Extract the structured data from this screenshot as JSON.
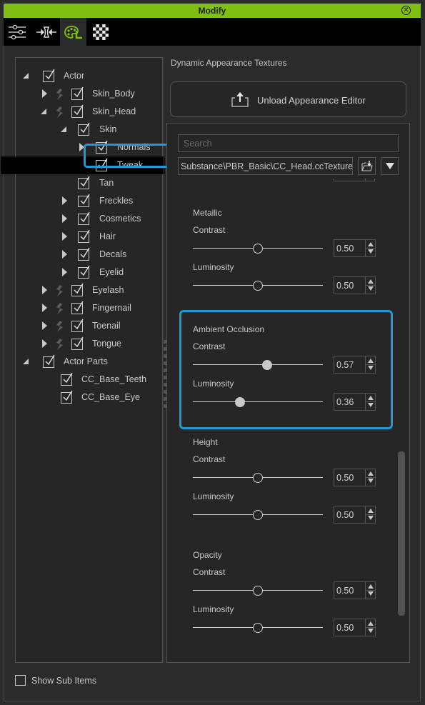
{
  "window": {
    "title": "Modify",
    "close_icon": "close-circle-icon"
  },
  "toolbar": {
    "tabs": [
      {
        "name": "sliders",
        "icon": "sliders-icon",
        "active": false
      },
      {
        "name": "morph",
        "icon": "morph-compress-icon",
        "active": false
      },
      {
        "name": "appearance",
        "icon": "appearance-palette-icon",
        "active": true
      },
      {
        "name": "texture",
        "icon": "checkerboard-icon",
        "active": false
      }
    ]
  },
  "tree": {
    "items": [
      {
        "label": "Actor",
        "level": 0,
        "expander": "expanded",
        "checked": true,
        "skin_icon": false
      },
      {
        "label": "Skin_Body",
        "level": 1,
        "expander": "collapsed",
        "checked": true,
        "skin_icon": true
      },
      {
        "label": "Skin_Head",
        "level": 1,
        "expander": "expanded",
        "checked": true,
        "skin_icon": true
      },
      {
        "label": "Skin",
        "level": 2,
        "expander": "expanded",
        "checked": true,
        "skin_icon": false
      },
      {
        "label": "Normals",
        "level": 3,
        "expander": "collapsed",
        "checked": true,
        "skin_icon": false
      },
      {
        "label": "Tweak",
        "level": 3,
        "expander": "none",
        "checked": true,
        "skin_icon": false,
        "selected": true
      },
      {
        "label": "Tan",
        "level": 2,
        "expander": "none",
        "checked": true,
        "skin_icon": false
      },
      {
        "label": "Freckles",
        "level": 2,
        "expander": "collapsed",
        "checked": true,
        "skin_icon": false
      },
      {
        "label": "Cosmetics",
        "level": 2,
        "expander": "collapsed",
        "checked": true,
        "skin_icon": false
      },
      {
        "label": "Hair",
        "level": 2,
        "expander": "collapsed",
        "checked": true,
        "skin_icon": false
      },
      {
        "label": "Decals",
        "level": 2,
        "expander": "collapsed",
        "checked": true,
        "skin_icon": false
      },
      {
        "label": "Eyelid",
        "level": 2,
        "expander": "collapsed",
        "checked": true,
        "skin_icon": false
      },
      {
        "label": "Eyelash",
        "level": 1,
        "expander": "collapsed",
        "checked": true,
        "skin_icon": true
      },
      {
        "label": "Fingernail",
        "level": 1,
        "expander": "collapsed",
        "checked": true,
        "skin_icon": true
      },
      {
        "label": "Toenail",
        "level": 1,
        "expander": "collapsed",
        "checked": true,
        "skin_icon": true
      },
      {
        "label": "Tongue",
        "level": 1,
        "expander": "collapsed",
        "checked": true,
        "skin_icon": true
      },
      {
        "label": "Actor Parts",
        "level": 0,
        "expander": "expanded",
        "checked": true,
        "skin_icon": false
      },
      {
        "label": "CC_Base_Teeth",
        "level": 1,
        "expander": "none",
        "checked": true,
        "skin_icon": false
      },
      {
        "label": "CC_Base_Eye",
        "level": 1,
        "expander": "none",
        "checked": true,
        "skin_icon": false
      }
    ]
  },
  "show_sub_items": {
    "label": "Show Sub Items",
    "checked": false
  },
  "right": {
    "section_title": "Dynamic Appearance Textures",
    "unload_button": {
      "label": "Unload Appearance Editor",
      "icon": "upload-tray-icon"
    },
    "search": {
      "placeholder": "Search",
      "value": ""
    },
    "path": {
      "value": "Substance\\PBR_Basic\\CC_Head.ccTexture"
    },
    "load_button_icon": "folder-load-icon",
    "dropdown_icon": "triangle-down-icon",
    "groups": [
      {
        "title": "Metallic",
        "highlighted": false,
        "params": [
          {
            "label": "Contrast",
            "value": "0.50",
            "fraction": 0.5,
            "knob": "outline"
          },
          {
            "label": "Luminosity",
            "value": "0.50",
            "fraction": 0.5,
            "knob": "outline"
          }
        ]
      },
      {
        "title": "Ambient Occlusion",
        "highlighted": true,
        "params": [
          {
            "label": "Contrast",
            "value": "0.57",
            "fraction": 0.57,
            "knob": "filled"
          },
          {
            "label": "Luminosity",
            "value": "0.36",
            "fraction": 0.36,
            "knob": "filled"
          }
        ]
      },
      {
        "title": "Height",
        "highlighted": false,
        "params": [
          {
            "label": "Contrast",
            "value": "0.50",
            "fraction": 0.5,
            "knob": "outline"
          },
          {
            "label": "Luminosity",
            "value": "0.50",
            "fraction": 0.5,
            "knob": "outline"
          }
        ]
      },
      {
        "title": "Opacity",
        "highlighted": false,
        "params": [
          {
            "label": "Contrast",
            "value": "0.50",
            "fraction": 0.5,
            "knob": "outline"
          },
          {
            "label": "Luminosity",
            "value": "0.50",
            "fraction": 0.5,
            "knob": "outline"
          }
        ]
      }
    ]
  },
  "colors": {
    "accent_green": "#7fbf12",
    "highlight_blue": "#1e9ad6",
    "background": "#2b2b2b"
  }
}
